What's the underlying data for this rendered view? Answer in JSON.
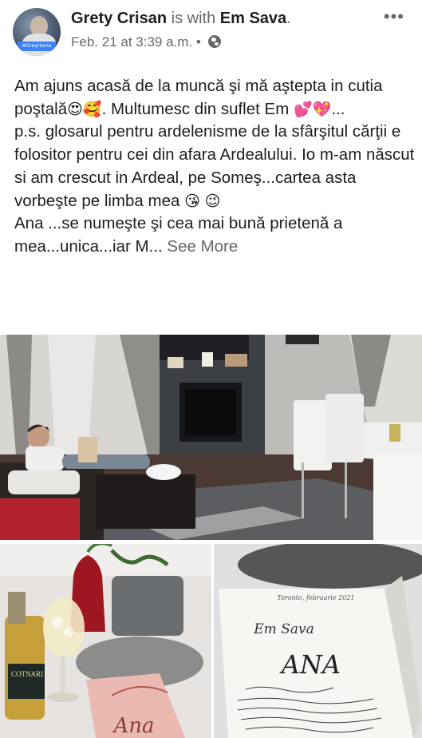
{
  "post": {
    "author": "Grety Crisan",
    "with_label": "is with",
    "tagged": "Em Sava",
    "tagged_suffix": ".",
    "timestamp": "Feb. 21 at 3:39 a.m.",
    "separator": "•",
    "privacy_icon": "globe-icon",
    "more_icon": "more-horizontal-icon",
    "more_glyph": "•••",
    "avatar_badge": "#GreyHome"
  },
  "text": {
    "line1": "Am ajuns acasă de la muncă şi mă aştepta in cutia poştală",
    "line1_end": ". Multumesc din suflet Em",
    "line2_end": "...",
    "line3": "p.s. glosarul pentru ardelenisme de la sfârşitul cărţii e folositor pentru cei din afara Ardealului. Io m-am născut si am crescut in Ardeal, pe Someş...cartea asta vorbeşte pe limba mea",
    "line4": "Ana ...se numeşte şi cea mai bună prietenă a mea...unica...iar M...",
    "see_more": "See More",
    "emoji_heart_eyes": "😍",
    "emoji_smiling_hearts": "🥰",
    "emoji_two_hearts": "💕",
    "emoji_sparkling_heart": "💖",
    "emoji_kiss": "😘",
    "emoji_wink": "😉"
  },
  "photos": {
    "book_cover_title": "ANA",
    "book_author_handwritten": "Em Sava",
    "book_city": "Toronto, februarie 2021",
    "book_note": "Dragă Grety, Ana ajunge acasă la tine. Poate tinuţi poate prezenţă Sosiţi una Ardeal. Poate ce o să iubeşti. Şi doresc să ajungă în sufletul tău cea mai bună. Te îmbrăţişez cu drag!",
    "book_spine_title": "Ana",
    "bottle_label": "COTNARI",
    "colors": {
      "wall": "#c9c7c4",
      "floor": "#4a3a33",
      "fireplace": "#3c3f44",
      "sofa": "#2b2624",
      "blanket": "#b3232e",
      "book_pink": "#e9b9b2"
    }
  }
}
